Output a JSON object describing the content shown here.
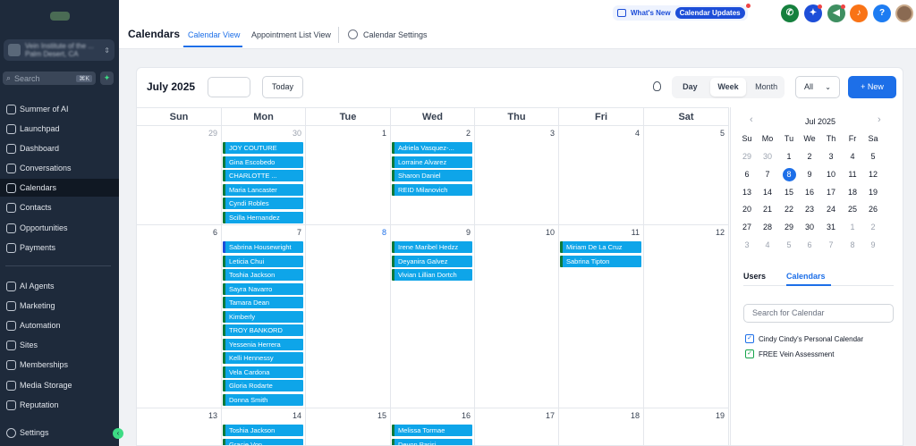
{
  "sidebar": {
    "account_name": "Vein Institute of the ...",
    "account_location": "Palm Desert, CA",
    "search_placeholder": "Search",
    "search_shortcut": "⌘K",
    "items": [
      {
        "label": "Summer of AI",
        "icon": "sparkle-icon",
        "active": false
      },
      {
        "label": "Launchpad",
        "icon": "rocket-icon",
        "active": false
      },
      {
        "label": "Dashboard",
        "icon": "dashboard-icon",
        "active": false
      },
      {
        "label": "Conversations",
        "icon": "chat-icon",
        "active": false
      },
      {
        "label": "Calendars",
        "icon": "calendar-icon",
        "active": true
      },
      {
        "label": "Contacts",
        "icon": "contacts-icon",
        "active": false
      },
      {
        "label": "Opportunities",
        "icon": "funnel-icon",
        "active": false
      },
      {
        "label": "Payments",
        "icon": "payments-icon",
        "active": false
      },
      {
        "label": "AI Agents",
        "icon": "sparkle-icon",
        "active": false
      },
      {
        "label": "Marketing",
        "icon": "megaphone-icon",
        "active": false
      },
      {
        "label": "Automation",
        "icon": "automation-icon",
        "active": false
      },
      {
        "label": "Sites",
        "icon": "sites-icon",
        "active": false
      },
      {
        "label": "Memberships",
        "icon": "memberships-icon",
        "active": false
      },
      {
        "label": "Media Storage",
        "icon": "media-icon",
        "active": false
      },
      {
        "label": "Reputation",
        "icon": "star-icon",
        "active": false
      }
    ],
    "settings_label": "Settings"
  },
  "header": {
    "title": "Calendars",
    "tabs": [
      "Calendar View",
      "Appointment List View",
      "Calendar Settings"
    ],
    "whats_new": "What's New",
    "calendar_updates": "Calendar Updates",
    "icons": [
      {
        "name": "phone-icon",
        "color": "#15803d",
        "glyph": "✆"
      },
      {
        "name": "magic-icon",
        "color": "#1d4ed8",
        "glyph": "✦"
      },
      {
        "name": "megaphone-icon",
        "color": "#3f8f61",
        "glyph": "◀"
      },
      {
        "name": "bell-icon",
        "color": "#f97316",
        "glyph": "♪"
      },
      {
        "name": "help-icon",
        "color": "#1d7cf2",
        "glyph": "?"
      }
    ]
  },
  "toolbar": {
    "month_title": "July 2025",
    "today_label": "Today",
    "views": [
      "Day",
      "Week",
      "Month"
    ],
    "filter_value": "All",
    "new_label": "+ New"
  },
  "calendar": {
    "weekdays": [
      "Sun",
      "Mon",
      "Tue",
      "Wed",
      "Thu",
      "Fri",
      "Sat"
    ],
    "weeks": [
      [
        "29",
        "30",
        "1",
        "2",
        "3",
        "4",
        "5"
      ],
      [
        "6",
        "7",
        "8",
        "9",
        "10",
        "11",
        "12"
      ],
      [
        "13",
        "14",
        "15",
        "16",
        "17",
        "18",
        "19"
      ]
    ],
    "events": {
      "0-1": [
        "JOY COUTURE",
        "Gina Escobedo",
        "CHARLOTTE ...",
        "Maria Lancaster",
        "Cyndi Robles",
        "Scilla Hernandez"
      ],
      "0-3": [
        "Adriela Vasquez-...",
        "Lorraine Alvarez",
        "Sharon Daniel",
        "REID Milanovich"
      ],
      "1-1": [
        "Sabrina Housewright",
        "Leticia Chui",
        "Toshia Jackson",
        "Sayra Navarro",
        "Tamara Dean",
        "Kimberly",
        "TROY BANKORD",
        "Yessenia Herrera",
        "Kelli Hennessy",
        "Vela Cardona",
        "Gloria Rodarte",
        "Donna Smith"
      ],
      "1-3": [
        "Irene Maribel Hedzz",
        "Deyanira Galvez",
        "Vivian Lillian Dortch"
      ],
      "1-5": [
        "Miriam De La Cruz",
        "Sabrina Tipton"
      ],
      "2-1": [
        "Toshia Jackson",
        "Gracie Von"
      ],
      "2-3": [
        "Melissa Tormae",
        "Devon Parisi"
      ]
    }
  },
  "mini_calendar": {
    "title": "Jul 2025",
    "weekdays": [
      "Su",
      "Mo",
      "Tu",
      "We",
      "Th",
      "Fr",
      "Sa"
    ],
    "days": [
      [
        "29",
        "30",
        "1",
        "2",
        "3",
        "4",
        "5"
      ],
      [
        "6",
        "7",
        "8",
        "9",
        "10",
        "11",
        "12"
      ],
      [
        "13",
        "14",
        "15",
        "16",
        "17",
        "18",
        "19"
      ],
      [
        "20",
        "21",
        "22",
        "23",
        "24",
        "25",
        "26"
      ],
      [
        "27",
        "28",
        "29",
        "30",
        "31",
        "1",
        "2"
      ],
      [
        "3",
        "4",
        "5",
        "6",
        "7",
        "8",
        "9"
      ]
    ],
    "selected": "8"
  },
  "side_panel": {
    "tabs": [
      "Users",
      "Calendars"
    ],
    "search_placeholder": "Search for Calendar",
    "calendars": [
      {
        "label": "Cindy Cindy's Personal Calendar",
        "color": "#1d6fe8"
      },
      {
        "label": "FREE Vein Assessment",
        "color": "#16a34a"
      }
    ]
  }
}
